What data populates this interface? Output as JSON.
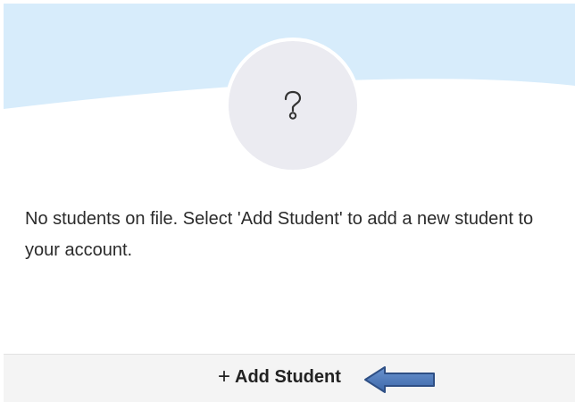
{
  "header": {
    "background_color": "#d7ecfb",
    "avatar_icon": "question-mark-icon"
  },
  "empty_state": {
    "message": "No students on file. Select 'Add Student' to add a new student to your account."
  },
  "footer": {
    "add_student": {
      "icon": "plus-icon",
      "plus": "+",
      "label": "Add Student"
    }
  },
  "annotation": {
    "arrow_direction": "left",
    "arrow_color": "#4a76b6"
  }
}
